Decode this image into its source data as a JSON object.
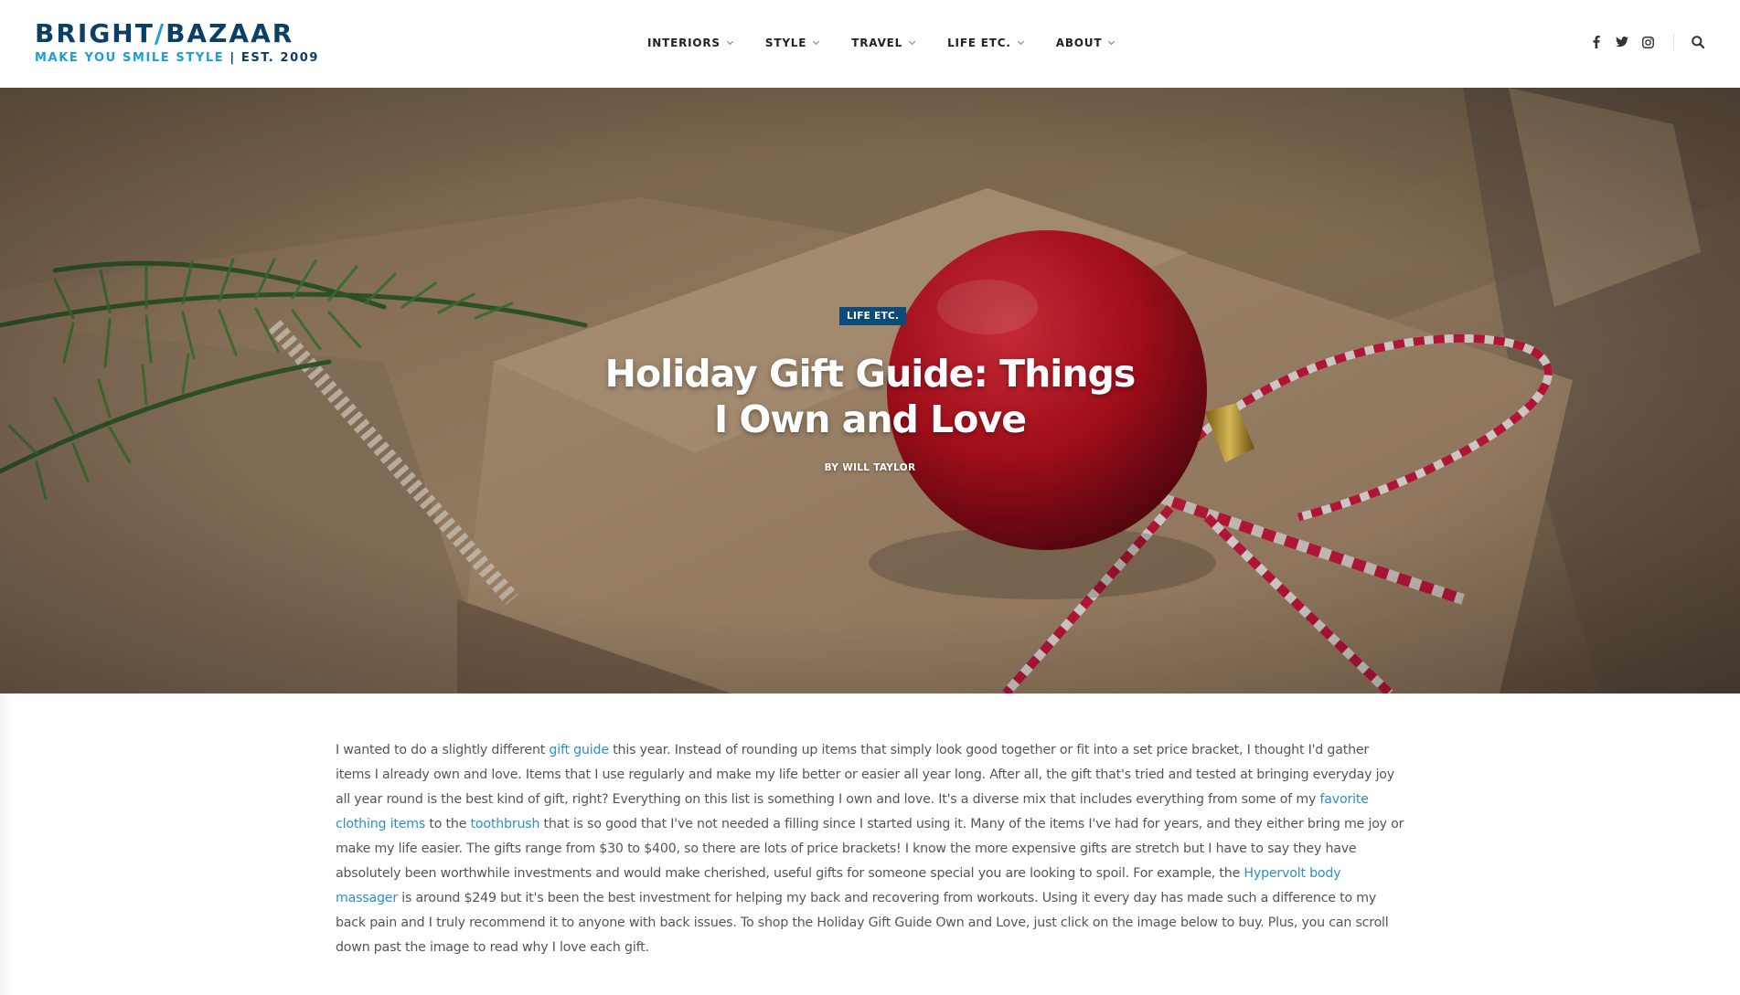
{
  "site": {
    "logo": {
      "part1": "BRIGHT",
      "slash": "/",
      "part2": "BAZAAR",
      "tagline": "MAKE YOU SMILE STYLE",
      "separator": "|",
      "est": "EST. 2009"
    }
  },
  "nav": {
    "items": [
      {
        "label": "INTERIORS"
      },
      {
        "label": "STYLE"
      },
      {
        "label": "TRAVEL"
      },
      {
        "label": "LIFE ETC."
      },
      {
        "label": "ABOUT"
      }
    ]
  },
  "social": {
    "icons": [
      "facebook-icon",
      "twitter-icon",
      "instagram-icon"
    ],
    "search_icon": "search-icon"
  },
  "hero": {
    "category": "LIFE ETC.",
    "title": "Holiday Gift Guide: Things I Own and Love",
    "byline_prefix": "BY",
    "author": "WILL TAYLOR"
  },
  "article": {
    "seg1": "I wanted to do a slightly different ",
    "link1": "gift guide",
    "seg2": " this year. Instead of rounding up items that simply look good together or fit into a set price bracket, I thought I'd gather items I already own and love. Items that I use regularly and make my life better or easier all year long. After all, the gift that's tried and tested at bringing everyday joy all year round is the best kind of gift, right? Everything on this list is something I own and love. It's a diverse mix that includes everything from some of my ",
    "link2": "favorite clothing items",
    "seg3": " to the ",
    "link3": "toothbrush",
    "seg4": " that is so good that I've not needed a filling since I started using it. Many of the items I've had for years, and they either bring me joy or make my life easier. The gifts range from $30 to $400, so there are lots of price brackets! I know the more expensive gifts are stretch but I have to say they have absolutely been worthwhile investments and would make cherished, useful gifts for someone special you are looking to spoil. For example, the ",
    "link4": "Hypervolt body massager",
    "seg5": " is around $249 but it's been the best investment for helping my back and recovering from workouts. Using it every day has made such a difference to my back pain and I truly recommend it to anyone with back issues. To shop the Holiday Gift Guide Own and Love, just click on the image below to buy. Plus, you can scroll down past the image to read why I love each gift."
  },
  "colors": {
    "brand_dark": "#0c3f66",
    "brand_light": "#1b9fd7",
    "badge": "#0c4a78",
    "link": "#2e8fc6"
  }
}
